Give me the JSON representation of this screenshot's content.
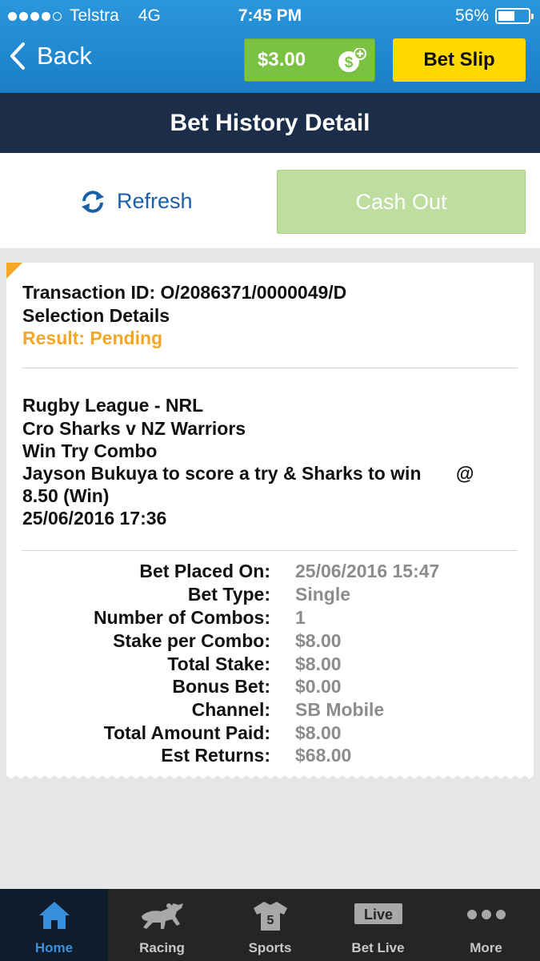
{
  "status_bar": {
    "carrier": "Telstra",
    "network": "4G",
    "time": "7:45 PM",
    "battery": "56%",
    "battery_level": 0.56
  },
  "nav": {
    "back_label": "Back",
    "balance": "$3.00",
    "bet_slip_label": "Bet Slip",
    "title": "Bet History Detail"
  },
  "actions": {
    "refresh_label": "Refresh",
    "cash_out_label": "Cash Out"
  },
  "bet": {
    "transaction_id": "Transaction ID: O/2086371/0000049/D",
    "selection_details": "Selection Details",
    "result": "Result: Pending",
    "sport": "Rugby League - NRL",
    "match": "Cro Sharks v NZ Warriors",
    "market": "Win Try Combo",
    "selection": "Jayson Bukuya to score a try & Sharks to win",
    "at_symbol": "@",
    "odds": "8.50 (Win)",
    "event_time": "25/06/2016 17:36"
  },
  "details": [
    {
      "label": "Bet Placed On:",
      "value": "25/06/2016 15:47"
    },
    {
      "label": "Bet Type:",
      "value": "Single"
    },
    {
      "label": "Number of Combos:",
      "value": "1"
    },
    {
      "label": "Stake per Combo:",
      "value": "$8.00"
    },
    {
      "label": "Total Stake:",
      "value": "$8.00"
    },
    {
      "label": "Bonus Bet:",
      "value": "$0.00"
    },
    {
      "label": "Channel:",
      "value": "SB Mobile"
    },
    {
      "label": "Total Amount Paid:",
      "value": "$8.00"
    },
    {
      "label": "Est Returns:",
      "value": "$68.00"
    }
  ],
  "tabs": [
    {
      "label": "Home",
      "icon": "home-icon"
    },
    {
      "label": "Racing",
      "icon": "horse-icon"
    },
    {
      "label": "Sports",
      "icon": "jersey-icon"
    },
    {
      "label": "Bet Live",
      "icon": "live-icon"
    },
    {
      "label": "More",
      "icon": "more-dots-icon"
    }
  ],
  "tab_live_badge": "Live",
  "jersey_number": "5",
  "colors": {
    "header_blue": "#1a7ec6",
    "title_navy": "#1b2d48",
    "balance_green": "#7cc242",
    "bet_slip_yellow": "#ffd900",
    "cash_out_disabled": "#bedea0",
    "pending_orange": "#f5a623",
    "active_tab_blue": "#3a8fdc"
  }
}
